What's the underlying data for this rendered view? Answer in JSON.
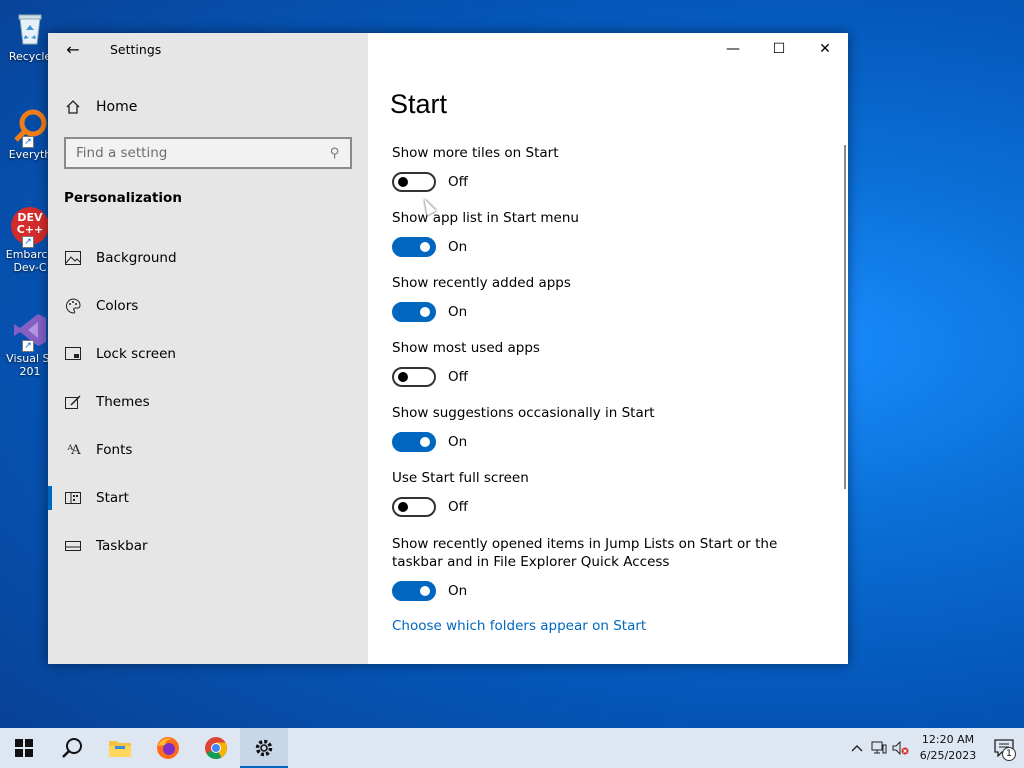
{
  "desktop": {
    "icons": [
      {
        "label": "Recycle",
        "name": "recycle-bin"
      },
      {
        "label": "Everyth",
        "name": "everything"
      },
      {
        "label": "Embarca\nDev-C",
        "name": "embarcadero-dev-cpp"
      },
      {
        "label": "Visual St\n201",
        "name": "visual-studio"
      }
    ],
    "devcpp_badge": "DEV\nC++"
  },
  "window": {
    "title": "Settings",
    "controls": {
      "minimize": "—",
      "maximize": "☐",
      "close": "✕"
    }
  },
  "sidebar": {
    "home_label": "Home",
    "search_placeholder": "Find a setting",
    "section_title": "Personalization",
    "items": [
      {
        "label": "Background",
        "icon": "picture-icon",
        "active": false
      },
      {
        "label": "Colors",
        "icon": "palette-icon",
        "active": false
      },
      {
        "label": "Lock screen",
        "icon": "lock-screen-icon",
        "active": false
      },
      {
        "label": "Themes",
        "icon": "themes-icon",
        "active": false
      },
      {
        "label": "Fonts",
        "icon": "fonts-icon",
        "active": false
      },
      {
        "label": "Start",
        "icon": "start-icon",
        "active": true
      },
      {
        "label": "Taskbar",
        "icon": "taskbar-icon",
        "active": false
      }
    ]
  },
  "main": {
    "title": "Start",
    "settings": [
      {
        "label": "Show more tiles on Start",
        "state": "Off",
        "on": false
      },
      {
        "label": "Show app list in Start menu",
        "state": "On",
        "on": true
      },
      {
        "label": "Show recently added apps",
        "state": "On",
        "on": true
      },
      {
        "label": "Show most used apps",
        "state": "Off",
        "on": false
      },
      {
        "label": "Show suggestions occasionally in Start",
        "state": "On",
        "on": true
      },
      {
        "label": "Use Start full screen",
        "state": "Off",
        "on": false
      },
      {
        "label": "Show recently opened items in Jump Lists on Start or the taskbar and in File Explorer Quick Access",
        "state": "On",
        "on": true
      }
    ],
    "link": "Choose which folders appear on Start"
  },
  "taskbar": {
    "apps": [
      "start-button",
      "search-button",
      "file-explorer",
      "firefox",
      "chrome",
      "settings"
    ],
    "clock_time": "12:20 AM",
    "clock_date": "6/25/2023",
    "notification_count": "1"
  },
  "colors": {
    "accent": "#0067c0",
    "sidebar_bg": "#e6e6e6",
    "taskbar_bg": "#dde6f1"
  }
}
